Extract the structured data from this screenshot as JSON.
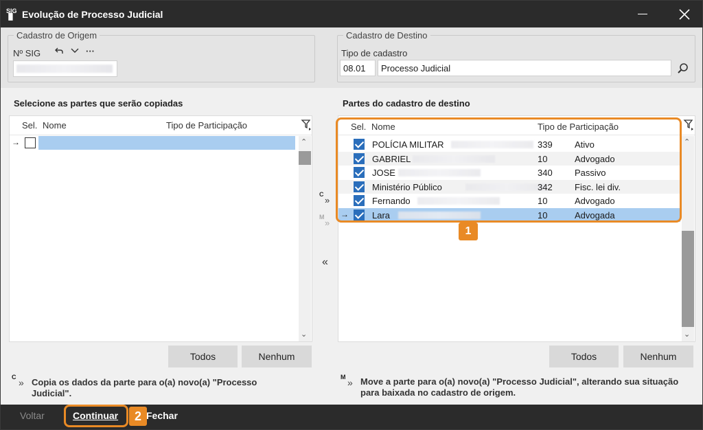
{
  "window": {
    "title": "Evolução de Processo Judicial"
  },
  "origin": {
    "legend": "Cadastro de Origem",
    "sig_label": "Nº SIG",
    "more_label": "···"
  },
  "destination": {
    "legend": "Cadastro de Destino",
    "type_label": "Tipo de cadastro",
    "type_code": "08.01",
    "type_name": "Processo Judicial"
  },
  "left_panel": {
    "title": "Selecione as partes que serão copiadas",
    "columns": [
      "Sel.",
      "Nome",
      "Tipo de Participação"
    ],
    "buttons": {
      "all": "Todos",
      "none": "Nenhum"
    }
  },
  "right_panel": {
    "title": "Partes do cadastro de destino",
    "columns": [
      "Sel.",
      "Nome",
      "Tipo de Participação"
    ],
    "rows": [
      {
        "name": "POLÍCIA MILITAR",
        "code": "339",
        "type": "Ativo"
      },
      {
        "name": "GABRIEL",
        "code": "10",
        "type": "Advogado"
      },
      {
        "name": "JOSE",
        "code": "340",
        "type": "Passivo"
      },
      {
        "name": "Ministério Público",
        "code": "342",
        "type": "Fisc. lei div."
      },
      {
        "name": "Fernando",
        "code": "10",
        "type": "Advogado"
      },
      {
        "name": "Lara",
        "code": "10",
        "type": "Advogada"
      }
    ],
    "buttons": {
      "all": "Todos",
      "none": "Nenhum"
    }
  },
  "move_buttons": {
    "copy": "C",
    "move": "M"
  },
  "hints": {
    "copy_key": "C",
    "copy": "Copia os dados da parte para o(a) novo(a) \"Processo Judicial\".",
    "move_key": "M",
    "move": "Move a parte para o(a) novo(a) \"Processo Judicial\", alterando sua situação para baixada no cadastro de origem."
  },
  "footer": {
    "back": "Voltar",
    "continue": "Continuar",
    "close": "Fechar"
  },
  "callouts": {
    "one": "1",
    "two": "2"
  },
  "colors": {
    "accent": "#e98a25",
    "selection": "#a9cdf0",
    "titlebar": "#2b2b2b",
    "check": "#2a6ebb"
  }
}
